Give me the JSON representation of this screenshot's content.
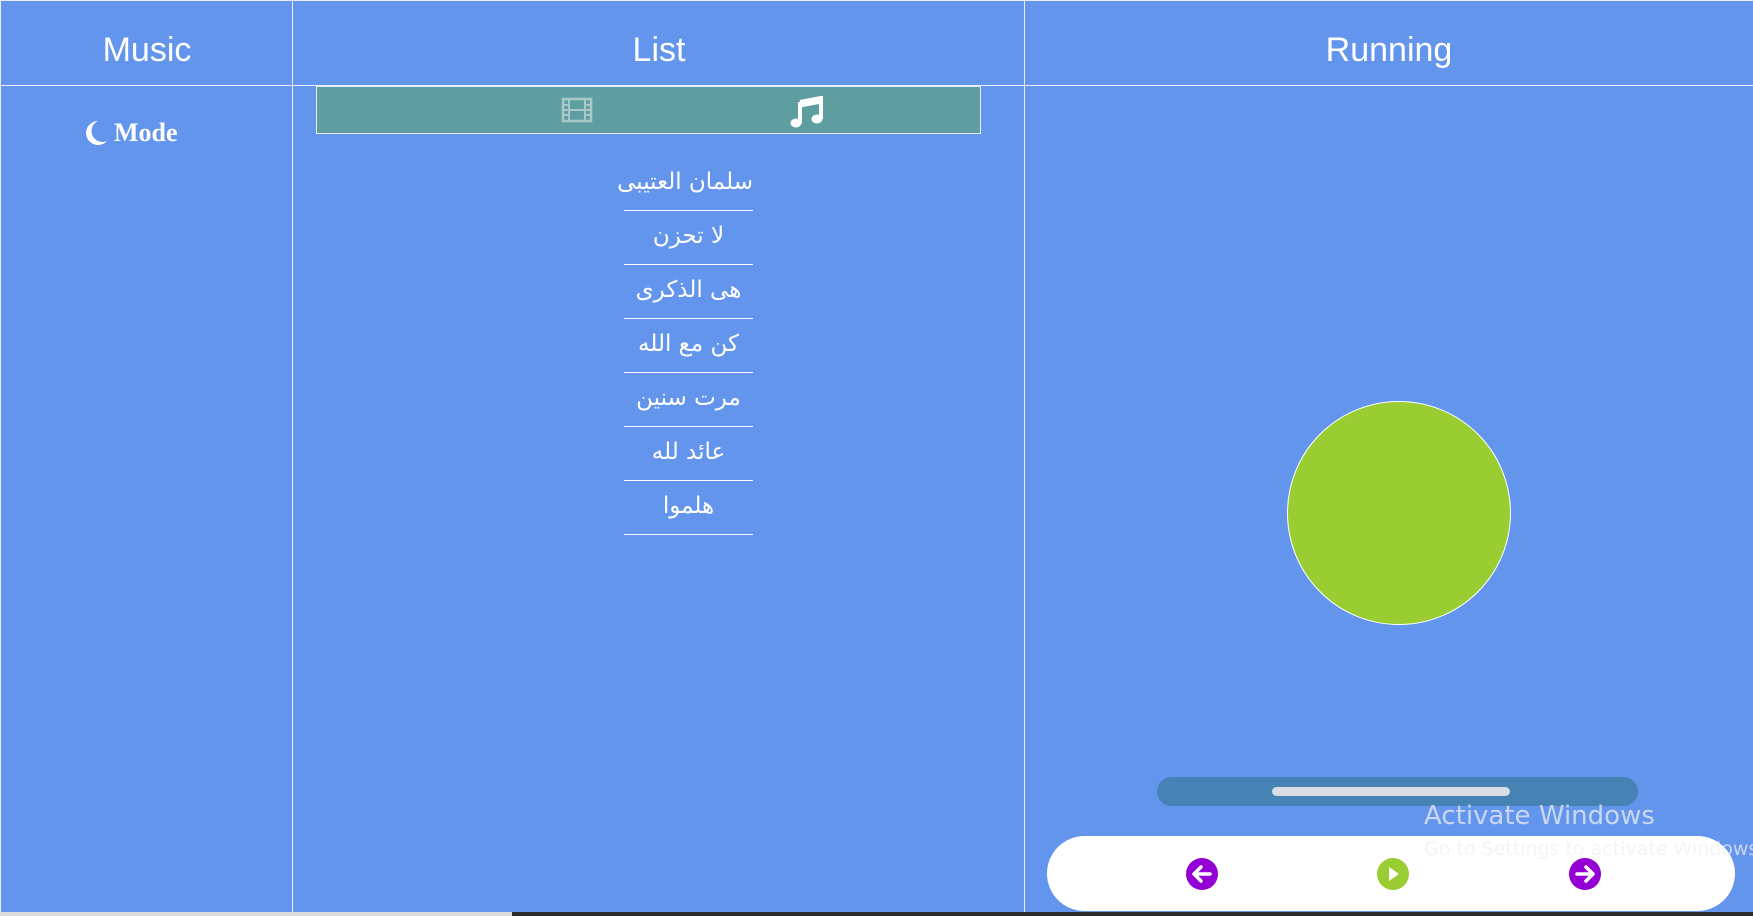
{
  "columns": {
    "music_title": "Music",
    "list_title": "List",
    "running_title": "Running"
  },
  "mode_toggle": {
    "icon": "moon-icon",
    "label": "Mode"
  },
  "list_tabs": [
    {
      "icon": "film-icon",
      "active": false
    },
    {
      "icon": "music-note-icon",
      "active": true
    }
  ],
  "songs": [
    "سلمان العتيبى",
    "لا تحزن",
    "هى الذكرى",
    "كن مع الله",
    "مرت سنين",
    "عائد لله",
    "هلموا"
  ],
  "player": {
    "progress": 0.5,
    "controls": [
      {
        "icon": "arrow-left-icon",
        "color": "#9400d3"
      },
      {
        "icon": "play-icon",
        "color": "#9acd32"
      },
      {
        "icon": "arrow-right-icon",
        "color": "#9400d3"
      }
    ]
  },
  "colors": {
    "background": "#6495ed",
    "tabbar": "#5f9ea0",
    "disc": "#9acd32",
    "progress_track": "#4682b4",
    "accent_purple": "#9400d3"
  },
  "watermark": {
    "title": "Activate Windows",
    "subtitle": "Go to Settings to activate Windows."
  }
}
